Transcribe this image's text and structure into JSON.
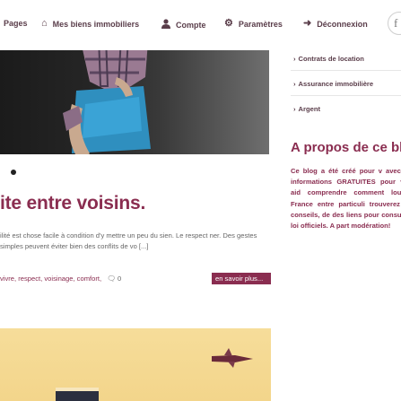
{
  "nav": {
    "items": [
      {
        "label": "Pages",
        "icon": "pages-icon"
      },
      {
        "label": "Mes biens immobiliers",
        "icon": "home-icon"
      },
      {
        "label": "Compte",
        "icon": "user-icon"
      },
      {
        "label": "Paramètres",
        "icon": "gears-icon"
      },
      {
        "label": "Déconnexion",
        "icon": "logout-icon"
      }
    ],
    "social": "f"
  },
  "post": {
    "title": "ite entre voisins.",
    "excerpt": "ilité est chose facile à condition d'y mettre un peu du sien. Le respect ner. Des gestes simples peuvent éviter bien des conflits de vo [...]",
    "tags": "vivre, respect, voisinage, comfort,",
    "comments": "0",
    "read_more": "en savoir plus..."
  },
  "sidebar": {
    "links": [
      "Contrats de location",
      "Assurance immobilière",
      "Argent"
    ],
    "about_title": "A propos de ce blog",
    "about_text": "Ce blog a été créé pour v avec des informations GRATUITES pour vous aid comprendre comment lou en France entre particuli trouverez des conseils, de des liens pour consulter l loi officiels. A part modération!"
  },
  "colors": {
    "accent": "#8a2d50",
    "nav_text": "#5a3d4a",
    "hero_bg": "#2a2a2a",
    "banner_bg": "#f4d78f"
  }
}
